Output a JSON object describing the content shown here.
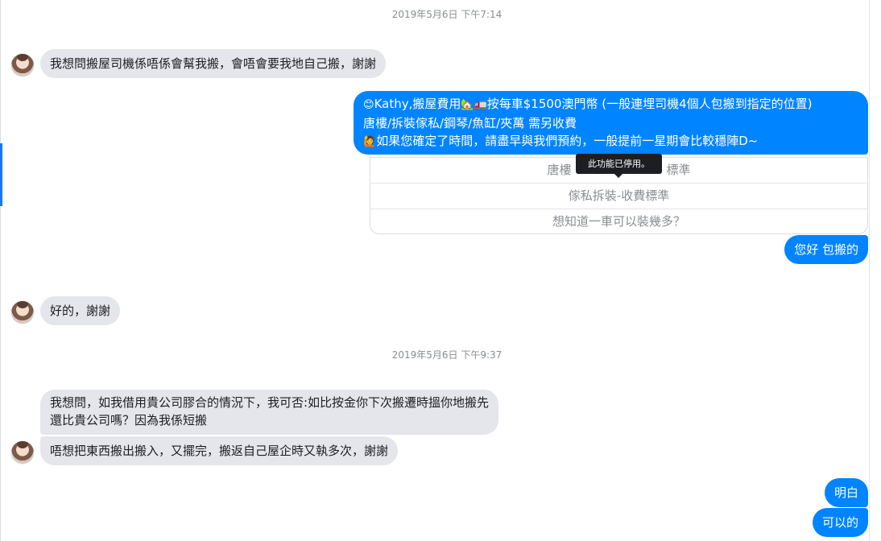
{
  "timestamps": [
    "2019年5月6日 下午7:14",
    "2019年5月6日 下午9:37"
  ],
  "messages": {
    "m1": "我想問搬屋司機係唔係會幫我搬，會唔會要我地自己搬，謝謝",
    "m2_line1": "Kathy,搬屋費用",
    "m2_line1b": "按每車$1500澳門幣 (一般連埋司機4個人包搬到指定的位置)",
    "m2_line2": "唐樓/拆裝傢私/鋼琴/魚缸/夾萬 需另收費",
    "m2_line3": "如果您確定了時間，請盡早與我們預約，一般提前一星期會比較穩陣D~",
    "m3": "您好 包搬的",
    "m4": "好的，謝謝",
    "m5_line1": "我想問，如我借用貴公司膠合的情況下，我可否:如比按金你下次搬遷時搵你地搬先",
    "m5_line2": "還比貴公司嗎？因為我係短搬",
    "m6": "唔想把東西搬出搬入，又擺完，搬返自己屋企時又執多次，謝謝",
    "m7": "明白",
    "m8": "可以的"
  },
  "quick_replies": {
    "q1_left": "唐樓",
    "q1_right": "標準",
    "q2": "傢私拆裝-收費標準",
    "q3": "想知道一車可以裝幾多？"
  },
  "tooltip": "此功能已停用。",
  "emojis": {
    "smile": "😊",
    "house": "🏡",
    "truck": "🚛",
    "person": "🙋"
  },
  "colors": {
    "outgoing_bubble": "#0084ff",
    "incoming_bubble": "#e4e6eb"
  }
}
